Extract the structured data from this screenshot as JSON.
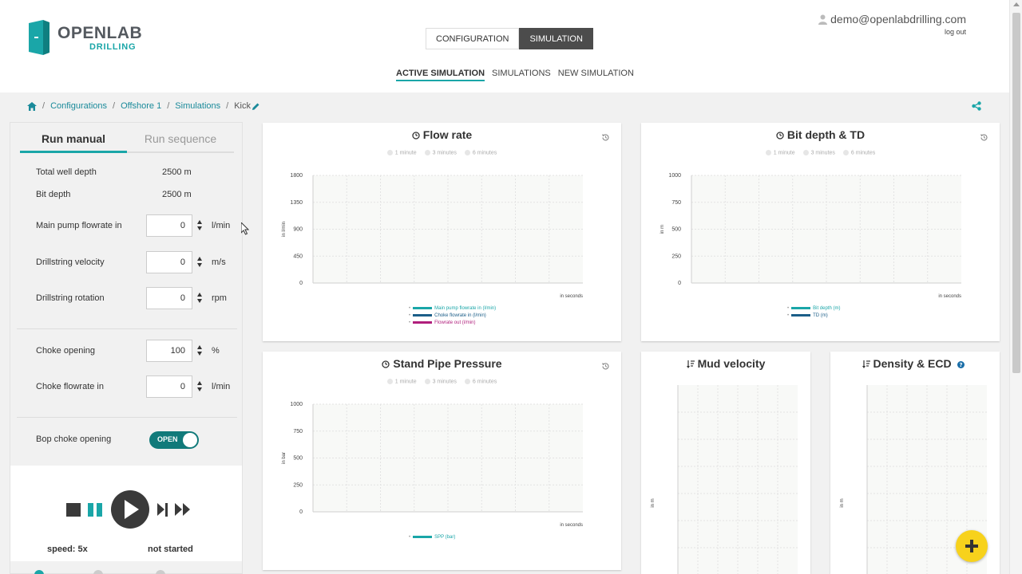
{
  "app": {
    "logo_title": "OPENLAB",
    "logo_sub": "DRILLING",
    "brand_color": "#1aa6a8"
  },
  "header": {
    "modes": [
      "CONFIGURATION",
      "SIMULATION"
    ],
    "active_mode": "SIMULATION",
    "subnav": [
      "ACTIVE SIMULATION",
      "SIMULATIONS",
      "NEW SIMULATION"
    ],
    "active_subnav": "ACTIVE SIMULATION",
    "user_email": "demo@openlabdrilling.com",
    "logout": "log out"
  },
  "breadcrumb": {
    "items": [
      "Configurations",
      "Offshore 1",
      "Simulations"
    ],
    "current": "Kick"
  },
  "left_panel": {
    "tabs": [
      "Run manual",
      "Run sequence"
    ],
    "active_tab": "Run manual",
    "info": [
      {
        "label": "Total well depth",
        "value": "2500 m"
      },
      {
        "label": "Bit depth",
        "value": "2500 m"
      }
    ],
    "fields": [
      {
        "label": "Main pump flowrate in",
        "value": "0",
        "unit": "l/min"
      },
      {
        "label": "Drillstring velocity",
        "value": "0",
        "unit": "m/s"
      },
      {
        "label": "Drillstring rotation",
        "value": "0",
        "unit": "rpm"
      },
      {
        "label": "Choke opening",
        "value": "100",
        "unit": "%"
      },
      {
        "label": "Choke flowrate in",
        "value": "0",
        "unit": "l/min"
      }
    ],
    "bop_label": "Bop choke opening",
    "bop_state": "OPEN",
    "speed": "speed: 5x",
    "status": "not started"
  },
  "range_options": [
    "1 minute",
    "3 minutes",
    "6 minutes"
  ],
  "charts": {
    "flow": {
      "title": "Flow rate",
      "ylabel": "in l/min",
      "xlabel": "in seconds",
      "yticks": [
        "1800",
        "1350",
        "900",
        "450",
        "0"
      ],
      "legend": [
        {
          "name": "Main pump flowrate in (l/min)",
          "color": "#1aa6a8"
        },
        {
          "name": "Choke flowrate in (l/min)",
          "color": "#1b5e88"
        },
        {
          "name": "Flowrate out (l/min)",
          "color": "#b01f7c"
        }
      ]
    },
    "bit": {
      "title": "Bit depth & TD",
      "ylabel": "in m",
      "xlabel": "in seconds",
      "yticks": [
        "1000",
        "750",
        "500",
        "250",
        "0"
      ],
      "legend": [
        {
          "name": "Bit depth (m)",
          "color": "#1aa6a8"
        },
        {
          "name": "TD (m)",
          "color": "#1b5e88"
        }
      ]
    },
    "spp": {
      "title": "Stand Pipe Pressure",
      "ylabel": "in bar",
      "xlabel": "in seconds",
      "yticks": [
        "1000",
        "750",
        "500",
        "250",
        "0"
      ],
      "legend": [
        {
          "name": "SPP (bar)",
          "color": "#1aa6a8"
        }
      ]
    },
    "mud": {
      "title": "Mud velocity",
      "ylabel": "in m"
    },
    "density": {
      "title": "Density & ECD",
      "ylabel": "in m"
    }
  }
}
